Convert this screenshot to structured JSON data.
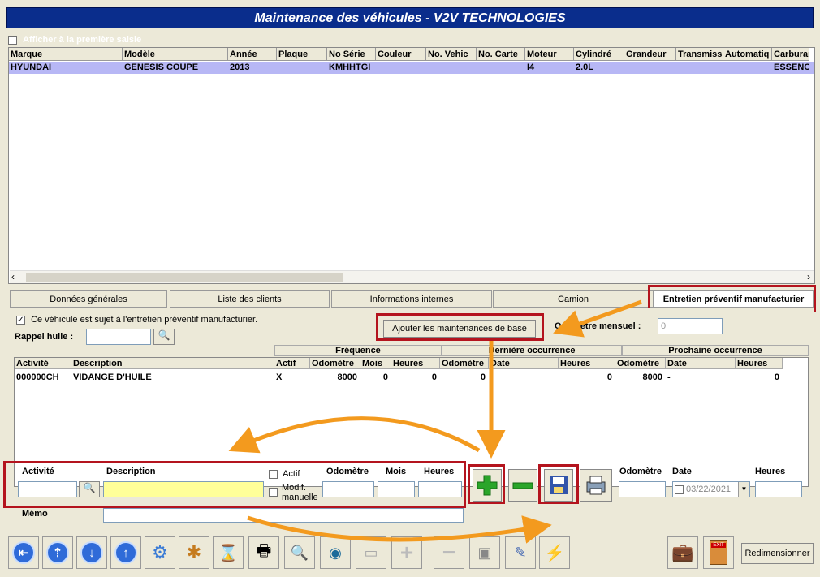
{
  "window": {
    "title": "Maintenance des véhicules - V2V TECHNOLOGIES"
  },
  "topbar": {
    "show_first_label": "Afficher à la première saisie"
  },
  "vehicle_grid": {
    "columns": [
      "Marque",
      "Modèle",
      "Année",
      "Plaque",
      "No Série",
      "Couleur",
      "No. Vehic",
      "No. Carte",
      "Moteur",
      "Cylindré",
      "Grandeur",
      "Transmiss",
      "Automatiq",
      "Carburan"
    ],
    "row": [
      "HYUNDAI",
      "GENESIS COUPE",
      "2013",
      "",
      "KMHHTGI",
      "",
      "",
      "",
      "I4",
      "2.0L",
      "",
      "",
      "",
      "ESSENC"
    ]
  },
  "tabs": [
    "Données générales",
    "Liste des clients",
    "Informations internes",
    "Camion",
    "Entretien préventif manufacturier"
  ],
  "maint": {
    "subject_label": "Ce véhicule est sujet à l'entretien préventif manufacturier.",
    "oil_label": "Rappel huile :",
    "add_base_button": "Ajouter les maintenances de base",
    "odometer_monthly_label": "Odomètre mensuel :",
    "odometer_monthly_value": "0"
  },
  "act_grid": {
    "groups": [
      "Fréquence",
      "Dernière occurrence",
      "Prochaine occurrence"
    ],
    "columns": [
      "Activité",
      "Description",
      "Actif",
      "Odomètre",
      "Mois",
      "Heures",
      "Odomètre",
      "Date",
      "Heures",
      "Odomètre",
      "Date",
      "Heures"
    ],
    "row": [
      "000000CH",
      "VIDANGE D'HUILE",
      "X",
      "8000",
      "0",
      "0",
      "0",
      "",
      "0",
      "8000",
      "-",
      "0"
    ]
  },
  "editor": {
    "activity_label": "Activité",
    "description_label": "Description",
    "actif_label": "Actif",
    "modif_label": "Modif. manuelle",
    "odometer_label": "Odomètre",
    "months_label": "Mois",
    "hours_label": "Heures",
    "odometer2_label": "Odomètre",
    "date_label": "Date",
    "date_value": "03/22/2021",
    "hours2_label": "Heures",
    "memo_label": "Mémo"
  },
  "footer": {
    "resize_button": "Redimensionner",
    "exit_sign": "EXIT"
  },
  "colors": {
    "title_bg": "#0a2d8c",
    "highlight": "#b4141e",
    "arrow": "#f39a1e",
    "selection": "#b7b7f5"
  }
}
